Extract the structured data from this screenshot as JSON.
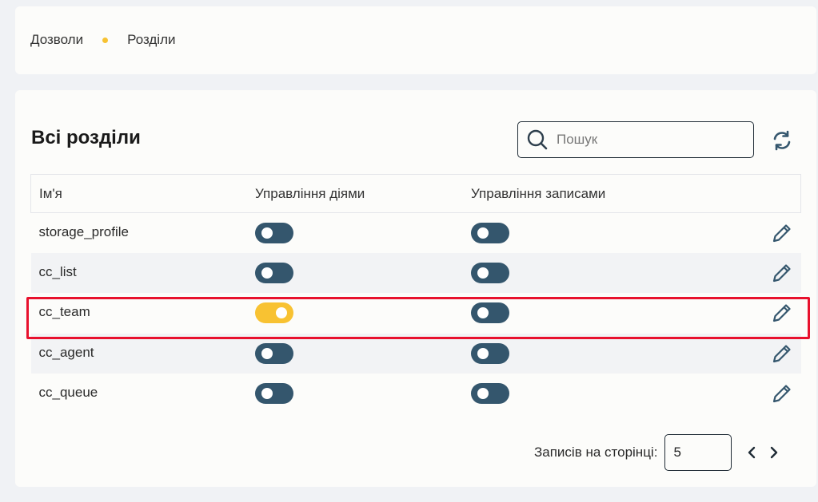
{
  "breadcrumb": {
    "items": [
      "Дозволи",
      "Розділи"
    ],
    "dot_color": "#f7c232"
  },
  "main": {
    "title": "Всі розділи",
    "search": {
      "placeholder": "Пошук",
      "value": ""
    },
    "icons": {
      "search": "search-icon",
      "refresh": "refresh-icon",
      "edit": "pencil-icon",
      "prev": "chevron-left-icon",
      "next": "chevron-right-icon"
    },
    "table": {
      "headers": [
        "Ім'я",
        "Управління діями",
        "Управління записами",
        ""
      ],
      "rows": [
        {
          "name": "storage_profile",
          "actions_enabled": false,
          "records_enabled": false
        },
        {
          "name": "cc_list",
          "actions_enabled": false,
          "records_enabled": false
        },
        {
          "name": "cc_team",
          "actions_enabled": true,
          "records_enabled": false,
          "highlighted": true
        },
        {
          "name": "cc_agent",
          "actions_enabled": false,
          "records_enabled": false
        },
        {
          "name": "cc_queue",
          "actions_enabled": false,
          "records_enabled": false
        }
      ]
    },
    "pagination": {
      "label": "Записів на сторінці:",
      "page_size": "5"
    }
  },
  "colors": {
    "toggle_off": "#34566d",
    "toggle_on": "#f8c232",
    "highlight": "#e8112d"
  }
}
